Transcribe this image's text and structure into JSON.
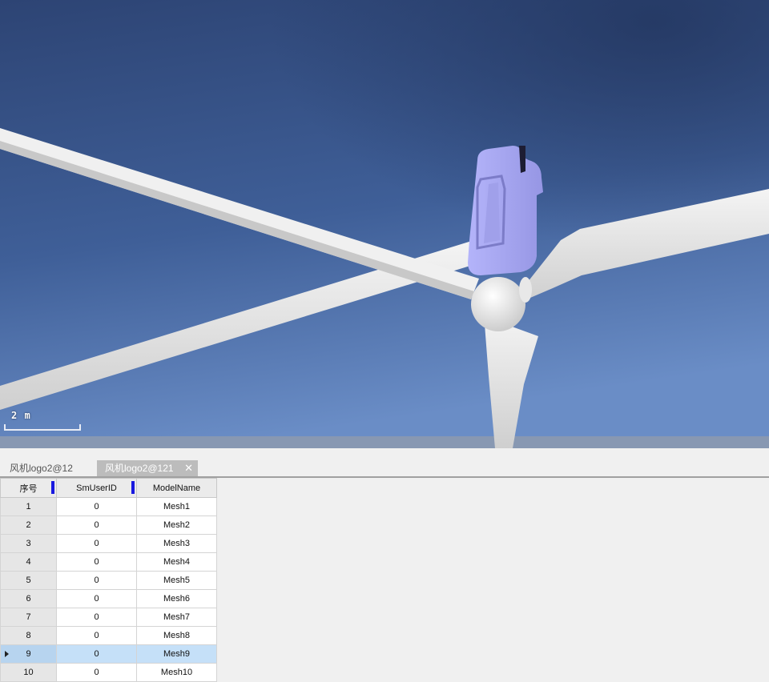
{
  "viewport": {
    "scale_label": "2 m",
    "colors": {
      "sky_top": "#2a3f6d",
      "sky_bottom": "#6a8cc4",
      "ground": "#8a9cb6",
      "blade": "#e6e6e6",
      "nacelle": "#aaaaf4"
    }
  },
  "tabs": [
    {
      "label": "风机logo2@12",
      "active": false
    },
    {
      "label": "风机logo2@121",
      "active": true,
      "close_icon": "close-icon"
    }
  ],
  "table": {
    "columns": [
      "序号",
      "SmUserID",
      "ModelName"
    ],
    "rows": [
      {
        "index": "1",
        "user_id": "0",
        "model": "Mesh1"
      },
      {
        "index": "2",
        "user_id": "0",
        "model": "Mesh2"
      },
      {
        "index": "3",
        "user_id": "0",
        "model": "Mesh3"
      },
      {
        "index": "4",
        "user_id": "0",
        "model": "Mesh4"
      },
      {
        "index": "5",
        "user_id": "0",
        "model": "Mesh5"
      },
      {
        "index": "6",
        "user_id": "0",
        "model": "Mesh6"
      },
      {
        "index": "7",
        "user_id": "0",
        "model": "Mesh7"
      },
      {
        "index": "8",
        "user_id": "0",
        "model": "Mesh8"
      },
      {
        "index": "9",
        "user_id": "0",
        "model": "Mesh9",
        "selected": true
      },
      {
        "index": "10",
        "user_id": "0",
        "model": "Mesh10"
      }
    ]
  }
}
